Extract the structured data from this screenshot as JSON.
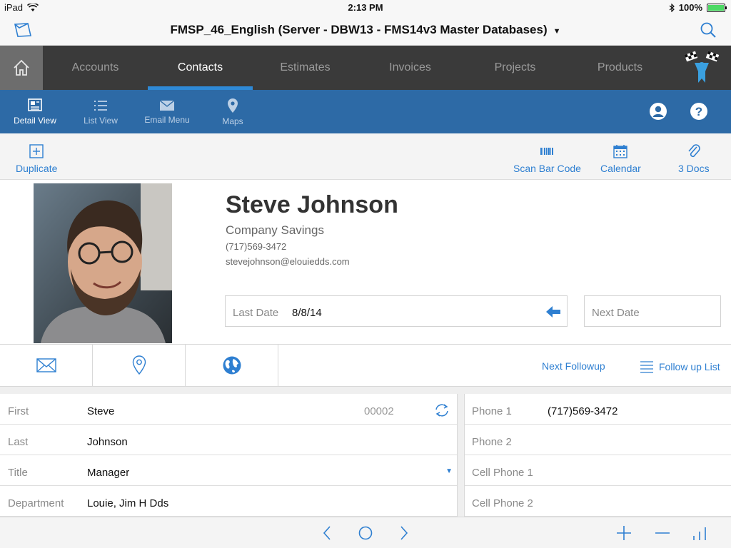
{
  "status_bar": {
    "device": "iPad",
    "time": "2:13 PM",
    "battery": "100%"
  },
  "title_bar": {
    "title": "FMSP_46_English (Server - DBW13 - FMS14v3 Master Databases)"
  },
  "top_nav": {
    "tabs": [
      {
        "label": "Accounts"
      },
      {
        "label": "Contacts"
      },
      {
        "label": "Estimates"
      },
      {
        "label": "Invoices"
      },
      {
        "label": "Projects"
      },
      {
        "label": "Products"
      }
    ],
    "active": "Contacts"
  },
  "toolbar": {
    "buttons": [
      {
        "label": "Detail View",
        "icon": "detail-view-icon"
      },
      {
        "label": "List View",
        "icon": "list-view-icon"
      },
      {
        "label": "Email Menu",
        "icon": "envelope-icon"
      },
      {
        "label": "Maps",
        "icon": "map-pin-icon"
      }
    ]
  },
  "actions": {
    "duplicate": "Duplicate",
    "scan_bar_code": "Scan Bar Code",
    "calendar": "Calendar",
    "docs": "3 Docs"
  },
  "contact": {
    "name": "Steve Johnson",
    "company": "Company Savings",
    "phone": "(717)569-3472",
    "email": "stevejohnson@elouiedds.com",
    "last_date_label": "Last Date",
    "last_date": "8/8/14",
    "next_date_label": "Next Date"
  },
  "followup": {
    "next_followup": "Next Followup",
    "followup_list": "Follow up List"
  },
  "fields_left": [
    {
      "label": "First",
      "value": "Steve"
    },
    {
      "label": "Last",
      "value": "Johnson"
    },
    {
      "label": "Title",
      "value": "Manager"
    },
    {
      "label": "Department",
      "value": "Louie, Jim H Dds"
    }
  ],
  "record_id": "00002",
  "fields_right": [
    {
      "label": "Phone 1",
      "value": "(717)569-3472"
    },
    {
      "label": "Phone 2",
      "value": ""
    },
    {
      "label": "Cell Phone 1",
      "value": ""
    },
    {
      "label": "Cell Phone 2",
      "value": ""
    }
  ],
  "colors": {
    "accent_blue": "#2e7fd1",
    "toolbar_blue": "#2d6aa6",
    "nav_dark": "#3a3a3a",
    "active_tab_underline": "#2e89d6"
  }
}
